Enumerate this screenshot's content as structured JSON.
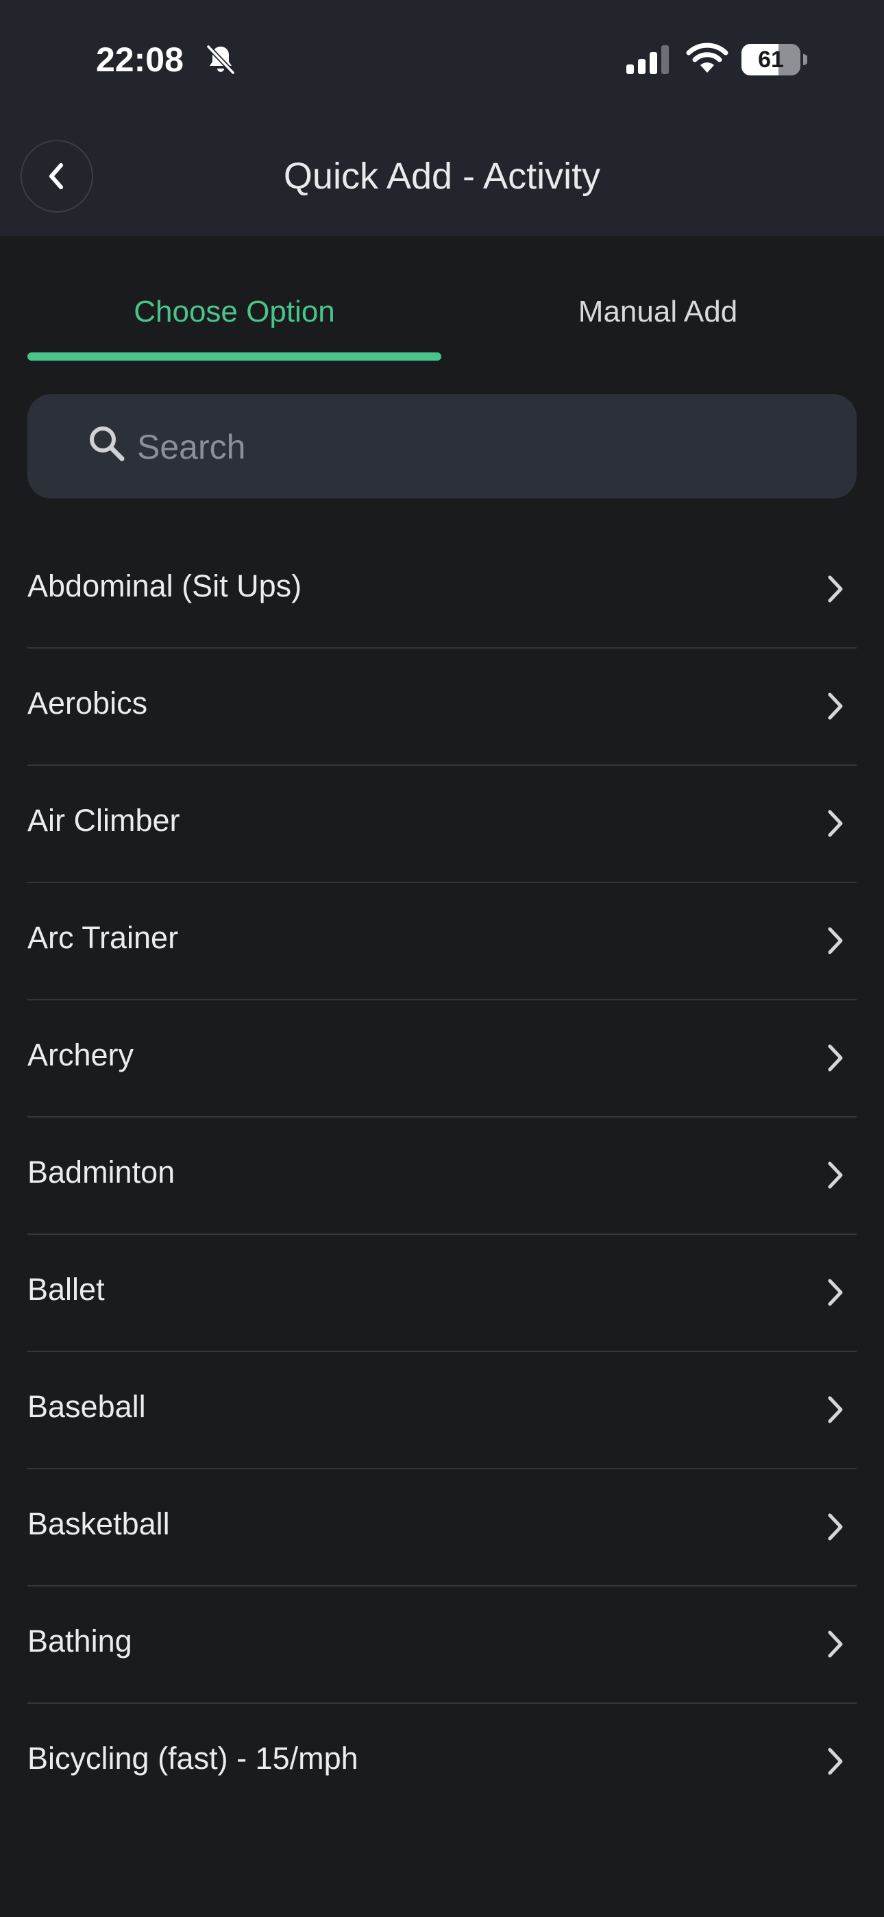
{
  "status_bar": {
    "time": "22:08",
    "battery": "61"
  },
  "header": {
    "title": "Quick Add - Activity"
  },
  "tabs": [
    {
      "label": "Choose Option",
      "active": true
    },
    {
      "label": "Manual Add",
      "active": false
    }
  ],
  "search": {
    "placeholder": "Search",
    "value": ""
  },
  "activities": [
    {
      "label": "Abdominal (Sit Ups)"
    },
    {
      "label": "Aerobics"
    },
    {
      "label": "Air Climber"
    },
    {
      "label": "Arc Trainer"
    },
    {
      "label": "Archery"
    },
    {
      "label": "Badminton"
    },
    {
      "label": "Ballet"
    },
    {
      "label": "Baseball"
    },
    {
      "label": "Basketball"
    },
    {
      "label": "Bathing"
    },
    {
      "label": "Bicycling (fast) - 15/mph"
    }
  ],
  "colors": {
    "accent": "#49c48b",
    "header_bg": "#23252c",
    "page_bg": "#1a1b1d",
    "search_bg": "#2c3038"
  },
  "icons": {
    "status": [
      "bell-slash-icon",
      "cellular-signal-icon",
      "wifi-icon",
      "battery-icon"
    ],
    "back": "chevron-left-icon",
    "search": "search-icon",
    "row": "chevron-right-icon"
  }
}
